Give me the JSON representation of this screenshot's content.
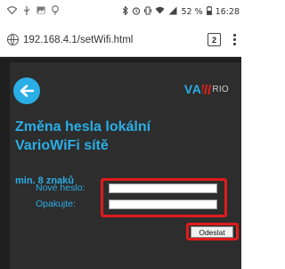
{
  "status_bar": {
    "battery_text": "52 %",
    "time": "16:28"
  },
  "browser": {
    "url": "192.168.4.1/setWifi.html",
    "tab_count": "2"
  },
  "page": {
    "logo_text": "VA",
    "logo_suffix": "RIO",
    "title_line1": "Změna hesla lokální",
    "title_line2": "VarioWiFi sítě",
    "subtitle": "min. 8 znaků",
    "form": {
      "new_password_label": "Nové heslo:",
      "confirm_label": "Opakujte:",
      "new_password_value": "",
      "confirm_value": ""
    },
    "send_button": "Odeslat"
  },
  "colors": {
    "accent": "#2aaee6",
    "highlight": "#e01b1b",
    "page_background": "#2d2d2d"
  }
}
